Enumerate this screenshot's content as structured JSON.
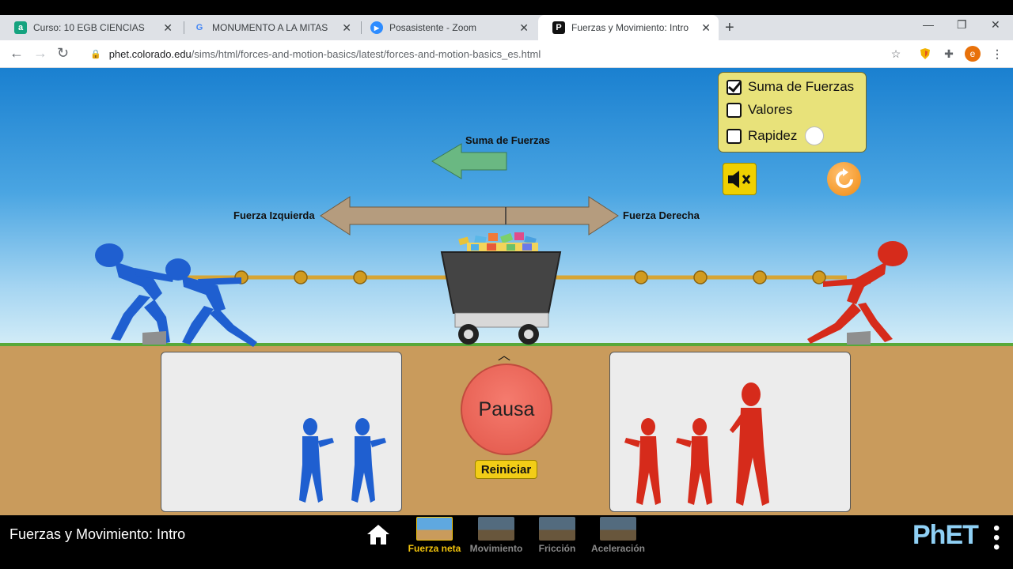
{
  "browser": {
    "tabs": [
      {
        "title": "Curso: 10 EGB CIENCIAS",
        "favicon": "a",
        "favicon_color": "#15a37f"
      },
      {
        "title": "MONUMENTO A LA MITAS DEL",
        "favicon": "G",
        "favicon_color": "#4285f4"
      },
      {
        "title": "Posasistente - Zoom",
        "favicon": "▶",
        "favicon_color": "#2d8cff"
      },
      {
        "title": "Fuerzas y Movimiento: Intro",
        "favicon": "P",
        "favicon_color": "#111111",
        "active": true
      }
    ],
    "url_host": "phet.colorado.edu",
    "url_path": "/sims/html/forces-and-motion-basics/latest/forces-and-motion-basics_es.html",
    "profile_initial": "e"
  },
  "sim": {
    "checkboxes": [
      {
        "label": "Suma de Fuerzas",
        "checked": true
      },
      {
        "label": "Valores",
        "checked": false
      },
      {
        "label": "Rapidez",
        "checked": false
      }
    ],
    "labels": {
      "sum_forces": "Suma de Fuerzas",
      "left_force": "Fuerza Izquierda",
      "right_force": "Fuerza Derecha"
    },
    "pause_label": "Pausa",
    "reset_label": "Reiniciar",
    "colors": {
      "left_team": "#1f5fd0",
      "right_team": "#d62b1b",
      "sum_arrow": "#6ab882",
      "force_arrow": "#b59c7e"
    }
  },
  "footer": {
    "sim_title": "Fuerzas y Movimiento: Intro",
    "screens": [
      {
        "label": "Fuerza neta",
        "selected": true
      },
      {
        "label": "Movimiento",
        "selected": false
      },
      {
        "label": "Fricción",
        "selected": false
      },
      {
        "label": "Aceleración",
        "selected": false
      }
    ],
    "brand": "PhET"
  }
}
